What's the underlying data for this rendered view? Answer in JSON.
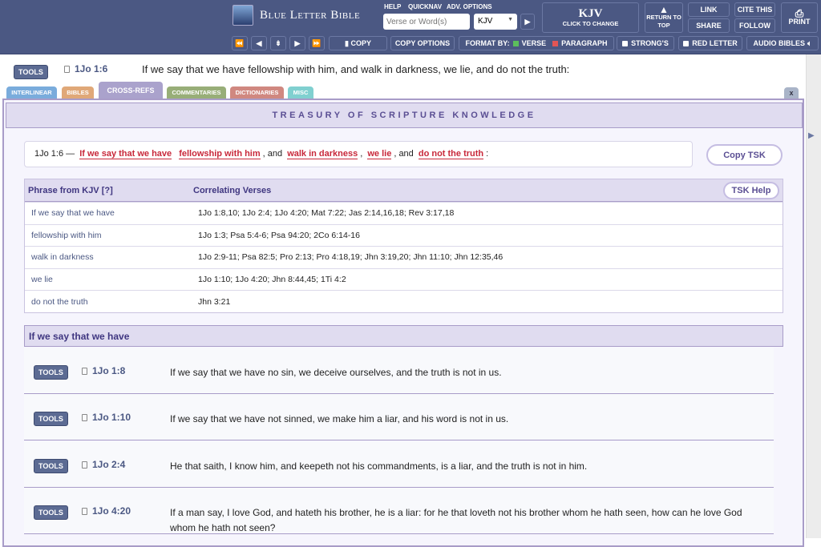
{
  "header": {
    "logo_text": "Blue Letter Bible",
    "help": "HELP",
    "quicknav": "QUICKNAV",
    "adv_options": "ADV. OPTIONS",
    "search_placeholder": "Verse or Word(s)",
    "version_select": "KJV",
    "version_big": "KJV",
    "version_sub": "CLICK TO CHANGE",
    "return_top": "RETURN TO TOP",
    "link": "LINK",
    "cite": "CITE THIS",
    "share": "SHARE",
    "follow": "FOLLOW",
    "print": "PRINT",
    "toolbar": {
      "copy": "COPY",
      "copy_options": "COPY OPTIONS",
      "format_by": "FORMAT BY:",
      "verse": "VERSE",
      "paragraph": "PARAGRAPH",
      "strongs": "STRONG'S",
      "red_letter": "RED LETTER",
      "audio": "AUDIO BIBLES"
    }
  },
  "verse": {
    "tools": "TOOLS",
    "ref": "1Jo 1:6",
    "text": "If we say that we have fellowship with him, and walk in darkness, we lie, and do not the truth:"
  },
  "tabs": [
    {
      "label": "INTERLINEAR",
      "color": "#7aacdc"
    },
    {
      "label": "BIBLES",
      "color": "#e0a878"
    },
    {
      "label": "CROSS-REFS",
      "color": "#aaa2cc"
    },
    {
      "label": "COMMENTARIES",
      "color": "#98ae78"
    },
    {
      "label": "DICTIONARIES",
      "color": "#d08880"
    },
    {
      "label": "MISC",
      "color": "#80d0d0"
    }
  ],
  "close": "x",
  "panel_title": "TREASURY OF SCRIPTURE KNOWLEDGE",
  "verse_box": {
    "ref": "1Jo 1:6 —",
    "p1": "If we say that we have",
    "p2": "fellowship with him",
    "s2": ", and",
    "p3": "walk in darkness",
    "s3": ",",
    "p4": "we lie",
    "s4": ", and",
    "p5": "do not the truth",
    "s5": ":"
  },
  "copy_tsk": "Copy TSK",
  "table": {
    "col1": "Phrase from KJV  [?]",
    "col2": "Correlating Verses",
    "help": "TSK Help",
    "rows": [
      {
        "phrase": "If we say that we have",
        "verses": "1Jo 1:8,10; 1Jo 2:4; 1Jo 4:20; Mat 7:22; Jas 2:14,16,18; Rev 3:17,18"
      },
      {
        "phrase": "fellowship with him",
        "verses": "1Jo 1:3; Psa 5:4-6; Psa 94:20; 2Co 6:14-16"
      },
      {
        "phrase": "walk in darkness",
        "verses": "1Jo 2:9-11; Psa 82:5; Pro 2:13; Pro 4:18,19; Jhn 3:19,20; Jhn 11:10; Jhn 12:35,46"
      },
      {
        "phrase": "we lie",
        "verses": "1Jo 1:10; 1Jo 4:20; Jhn 8:44,45; 1Ti 4:2"
      },
      {
        "phrase": "do not the truth",
        "verses": "Jhn 3:21"
      }
    ]
  },
  "section": {
    "title": "If we say that we have",
    "entries": [
      {
        "tools": "TOOLS",
        "ref": "1Jo 1:8",
        "text": "If we say that we have no sin, we deceive ourselves, and the truth is not in us."
      },
      {
        "tools": "TOOLS",
        "ref": "1Jo 1:10",
        "text": "If we say that we have not sinned, we make him a liar, and his word is not in us."
      },
      {
        "tools": "TOOLS",
        "ref": "1Jo 2:4",
        "text": "He that saith, I know him, and keepeth not his commandments, is a liar, and the truth is not in him."
      },
      {
        "tools": "TOOLS",
        "ref": "1Jo 4:20",
        "text": "If a man say, I love God, and hateth his brother, he is a liar: for he that loveth not his brother whom he hath seen, how can he love God whom he hath not seen?"
      }
    ]
  }
}
